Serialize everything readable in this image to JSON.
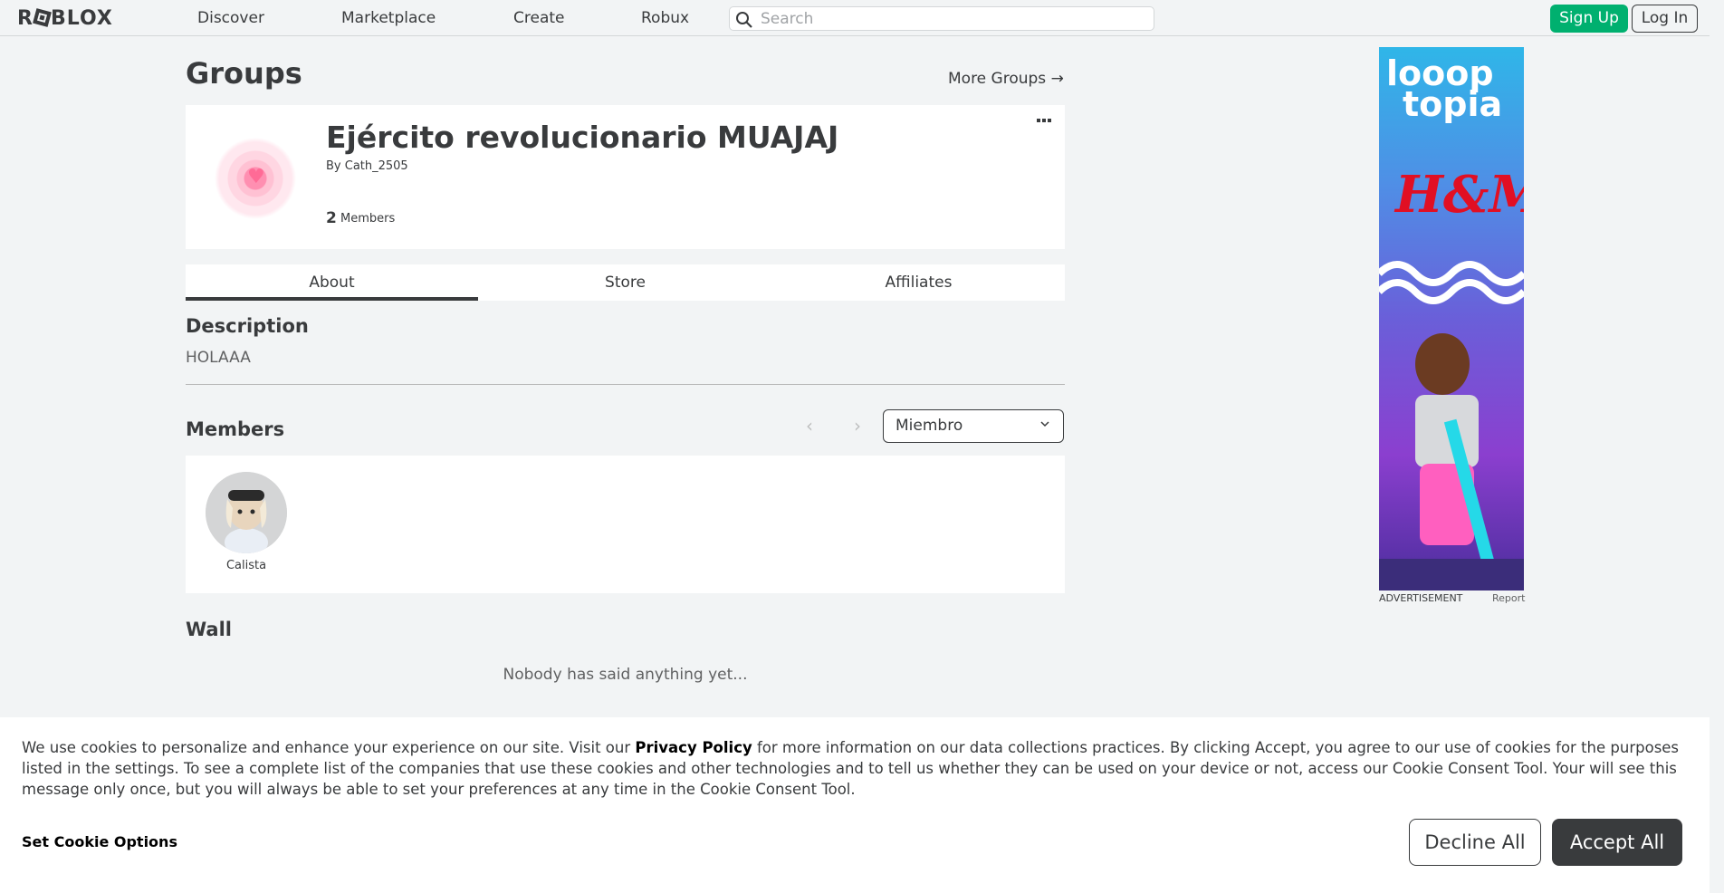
{
  "nav": {
    "logo": "ROBLOX",
    "links": [
      "Discover",
      "Marketplace",
      "Create",
      "Robux"
    ],
    "search_placeholder": "Search",
    "signup_label": "Sign Up",
    "login_label": "Log In"
  },
  "page": {
    "title": "Groups",
    "more_groups": "More Groups →"
  },
  "group": {
    "name": "Ejército revolucionario MUAJAJ",
    "owner_line": "By Cath_2505",
    "member_count": "2",
    "member_label": "Members",
    "menu_icon": "more-dots-icon"
  },
  "tabs": [
    "About",
    "Store",
    "Affiliates"
  ],
  "about": {
    "description_heading": "Description",
    "description_text": "HOLAAA",
    "members_heading": "Members",
    "role_dropdown_value": "Miembro",
    "members": [
      {
        "name": "Calista"
      }
    ],
    "wall_heading": "Wall",
    "wall_empty": "Nobody has said anything yet..."
  },
  "ad": {
    "label": "ADVERTISEMENT",
    "report": "Report",
    "brand_line1": "looop",
    "brand_line2": "topia",
    "brand_logo": "H&M"
  },
  "cookie": {
    "text_before": "We use cookies to personalize and enhance your experience on our site. Visit our ",
    "policy_link": "Privacy Policy",
    "text_after": " for more information on our data collections practices. By clicking Accept, you agree to our use of cookies for the purposes listed in the settings. To see a complete list of the companies that use these cookies and other technologies and to tell us whether they can be used on your device or not, access our Cookie Consent Tool. Your will see this message only once, but you will always be able to set your preferences at any time in the Cookie Consent Tool.",
    "set_options": "Set Cookie Options",
    "decline": "Decline All",
    "accept": "Accept All"
  },
  "colors": {
    "accent_green": "#00b06f",
    "text_dark": "#393b3d",
    "page_bg": "#f2f4f5"
  }
}
